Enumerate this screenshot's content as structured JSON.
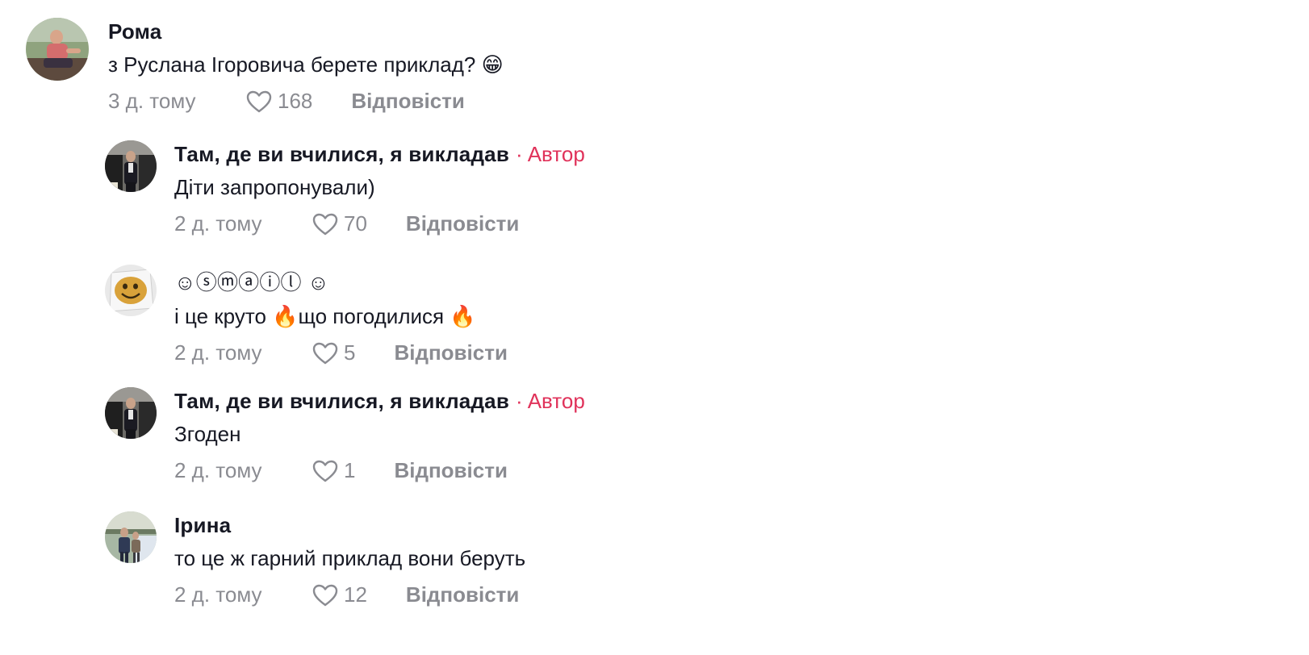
{
  "comments": [
    {
      "username": "Рома",
      "text": "з Руслана Ігоровича берете приклад? 😁",
      "time": "3 д. тому",
      "likes": "168",
      "reply": "Відповісти"
    },
    {
      "username": "Там, де ви вчилися, я викладав",
      "author_dot": "·",
      "author_tag": "Автор",
      "text": "Діти запропонували)",
      "time": "2 д. тому",
      "likes": "70",
      "reply": "Відповісти"
    },
    {
      "username": "☺ⓢⓜⓐⓘⓛ ☺",
      "text": "і це круто 🔥що погодилися 🔥",
      "time": "2 д. тому",
      "likes": "5",
      "reply": "Відповісти"
    },
    {
      "username": "Там, де ви вчилися, я викладав",
      "author_dot": "·",
      "author_tag": "Автор",
      "text": "Згоден",
      "time": "2 д. тому",
      "likes": "1",
      "reply": "Відповісти"
    },
    {
      "username": "Ірина",
      "text": "то це ж гарний приклад вони беруть",
      "time": "2 д. тому",
      "likes": "12",
      "reply": "Відповісти"
    }
  ],
  "colors": {
    "author_accent": "#e0325a",
    "meta_gray": "#8a8b91",
    "text_dark": "#161823"
  },
  "icons": {
    "like": "heart-outline-icon"
  }
}
